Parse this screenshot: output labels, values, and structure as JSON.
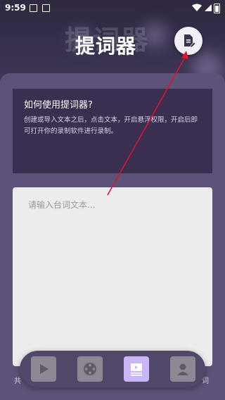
{
  "status_bar": {
    "time": "9:59"
  },
  "header": {
    "title": "提词器",
    "title_shadow": "提词器"
  },
  "help": {
    "heading": "如何使用提词器?",
    "text": "创建或导入文本之后，点击文本，开启悬浮权限，开启后即 可打开你的录制软件进行录制。"
  },
  "editor": {
    "placeholder": "请输入台词文本..."
  },
  "side_labels": {
    "left": "共",
    "right": "词"
  },
  "colors": {
    "accent": "#c8b6f6",
    "panel": "#5d5278",
    "help_bg": "#3a2f50",
    "arrow": "#e0142d"
  },
  "bottom_nav": {
    "items": [
      {
        "icon": "play-icon",
        "active": false
      },
      {
        "icon": "film-reel-icon",
        "active": false
      },
      {
        "icon": "teleprompter-icon",
        "active": true
      },
      {
        "icon": "profile-icon",
        "active": false
      }
    ]
  }
}
